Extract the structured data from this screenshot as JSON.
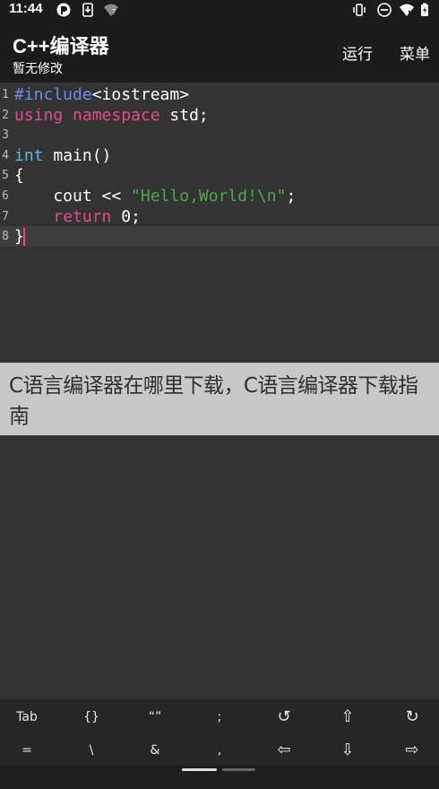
{
  "status_bar": {
    "time": "11:44",
    "icons": [
      "app-logo-icon",
      "phone-download-icon",
      "wifi-question-icon",
      "vibrate-icon",
      "do-not-disturb-icon",
      "wifi-x-icon",
      "battery-charging-icon"
    ]
  },
  "app_bar": {
    "title": "C++编译器",
    "subtitle": "暂无修改",
    "run_label": "运行",
    "menu_label": "菜单"
  },
  "editor": {
    "lines": [
      {
        "num": "1",
        "segments": [
          {
            "t": "#include",
            "c": "pre"
          },
          {
            "t": "<iostream>",
            "c": "plain"
          }
        ]
      },
      {
        "num": "2",
        "segments": [
          {
            "t": "using",
            "c": "kw"
          },
          {
            "t": " ",
            "c": "plain"
          },
          {
            "t": "namespace",
            "c": "kw"
          },
          {
            "t": " std;",
            "c": "plain"
          }
        ]
      },
      {
        "num": "3",
        "segments": []
      },
      {
        "num": "4",
        "segments": [
          {
            "t": "int",
            "c": "type"
          },
          {
            "t": " main()",
            "c": "plain"
          }
        ]
      },
      {
        "num": "5",
        "segments": [
          {
            "t": "{",
            "c": "plain"
          }
        ]
      },
      {
        "num": "6",
        "segments": [
          {
            "t": "    cout << ",
            "c": "plain"
          },
          {
            "t": "\"Hello,World!\\n\"",
            "c": "str"
          },
          {
            "t": ";",
            "c": "plain"
          }
        ]
      },
      {
        "num": "7",
        "segments": [
          {
            "t": "    ",
            "c": "plain"
          },
          {
            "t": "return",
            "c": "kw"
          },
          {
            "t": " 0;",
            "c": "plain"
          }
        ]
      },
      {
        "num": "8",
        "segments": [
          {
            "t": "}",
            "c": "plain"
          }
        ]
      }
    ]
  },
  "banner": {
    "text": "C语言编译器在哪里下载，C语言编译器下载指南"
  },
  "keyboard": {
    "row1": [
      "Tab",
      "{}",
      "“”",
      ";",
      "↺",
      "⇧",
      "↻"
    ],
    "row2": [
      "=",
      "\\",
      "&",
      ",",
      "⇦",
      "⇩",
      "⇨"
    ]
  },
  "colors": {
    "background": "#333333",
    "app_bar": "#1b1b1b",
    "preprocessor": "#6a8cf2",
    "keyword": "#e64a8c",
    "type": "#58b7dc",
    "string": "#49a94c",
    "cursor": "#ff3f7f",
    "banner": "#c8c8c8"
  }
}
